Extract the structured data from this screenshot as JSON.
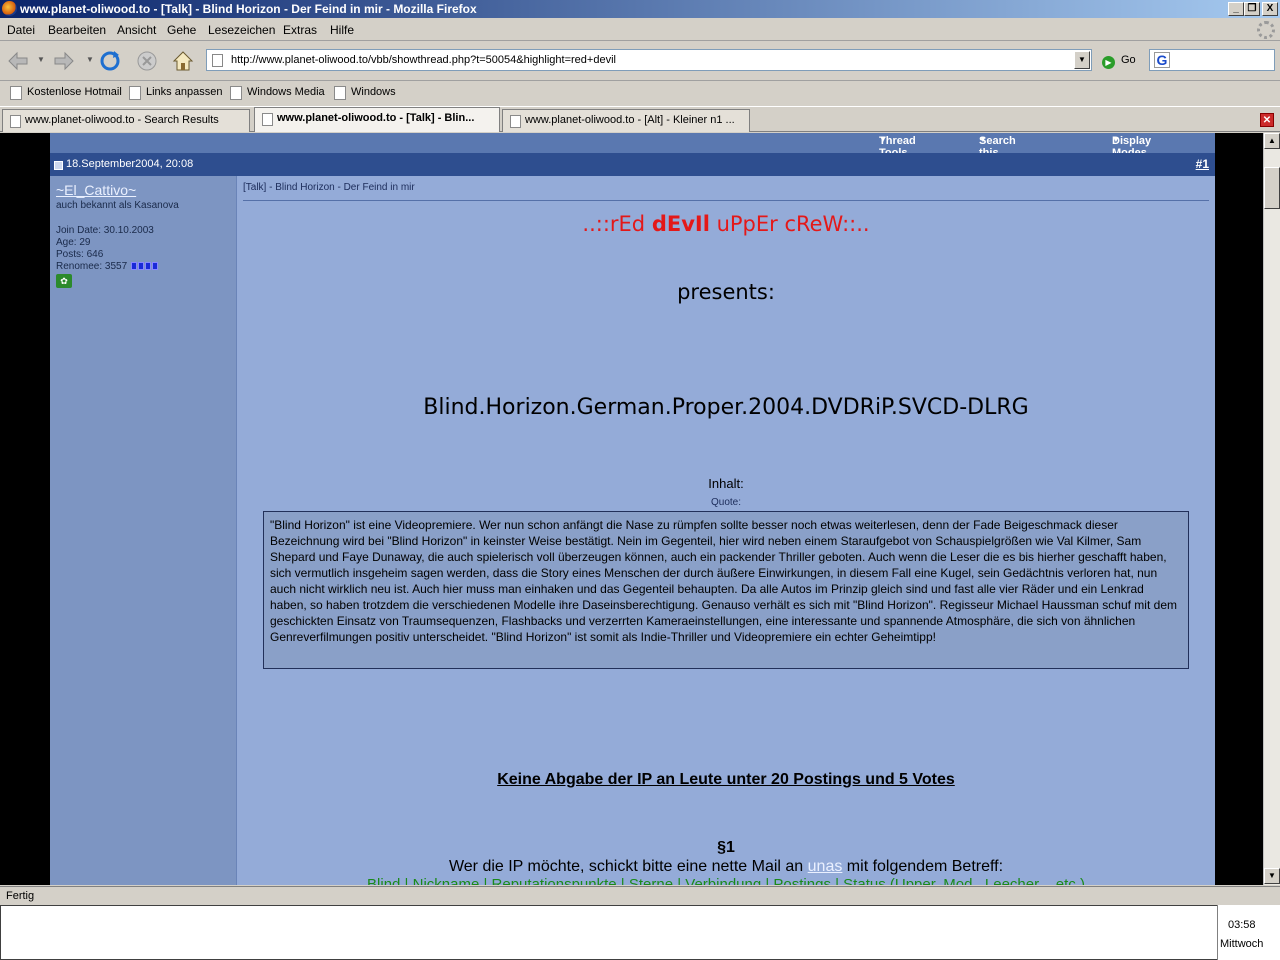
{
  "window": {
    "title": "www.planet-oliwood.to - [Talk] - Blind Horizon - Der Feind in mir - Mozilla Firefox",
    "controls": [
      "_",
      "❐",
      "X"
    ]
  },
  "menu": [
    "Datei",
    "Bearbeiten",
    "Ansicht",
    "Gehe",
    "Lesezeichen",
    "Extras",
    "Hilfe"
  ],
  "nav": {
    "url": "http://www.planet-oliwood.to/vbb/showthread.php?t=50054&highlight=red+devil",
    "go_label": "Go"
  },
  "bookmarks": [
    "Kostenlose Hotmail",
    "Links anpassen",
    "Windows Media",
    "Windows"
  ],
  "tabs": [
    {
      "label": "www.planet-oliwood.to - Search Results",
      "active": false
    },
    {
      "label": "www.planet-oliwood.to - [Talk] - Blin...",
      "active": true
    },
    {
      "label": "www.planet-oliwood.to - [Alt] - Kleiner n1 ...",
      "active": false
    }
  ],
  "thread_tools": [
    "Thread Tools",
    "Search this Thread",
    "Display Modes"
  ],
  "post": {
    "date": "18.September2004, 20:08",
    "number": "#1",
    "user": {
      "name": "~El_Cattivo~",
      "title": "auch bekannt als Kasanova",
      "join_date": "Join Date: 30.10.2003",
      "age": "Age: 29",
      "posts": "Posts: 646",
      "renomee": "Renomee: 3557"
    },
    "title": "[Talk] - Blind Horizon - Der Feind in mir",
    "crew_pre": "..::rEd ",
    "crew_bold": "dEvIl",
    "crew_post": " uPpEr cReW::..",
    "presents": "presents:",
    "release": "Blind.Horizon.German.Proper.2004.DVDRiP.SVCD-DLRG",
    "inhalt": "Inhalt:",
    "quote_label": "Quote:",
    "quote": "\"Blind Horizon\" ist eine Videopremiere. Wer nun schon anfängt die Nase zu rümpfen sollte besser noch etwas weiterlesen, denn der Fade Beigeschmack dieser Bezeichnung wird bei \"Blind Horizon\" in keinster Weise bestätigt. Nein im Gegenteil, hier wird neben einem Staraufgebot von Schauspielgrößen wie Val Kilmer, Sam Shepard und Faye Dunaway, die auch spielerisch voll überzeugen können, auch ein packender Thriller geboten. Auch wenn die Leser die es bis hierher geschafft haben, sich vermutlich insgeheim sagen werden, dass die Story eines Menschen der durch äußere Einwirkungen, in diesem Fall eine Kugel, sein Gedächtnis verloren hat, nun auch nicht wirklich neu ist. Auch hier muss man einhaken und das Gegenteil behaupten. Da alle Autos im Prinzip gleich sind und fast alle vier Räder und ein Lenkrad haben, so haben trotzdem die verschiedenen Modelle ihre Daseinsberechtigung. Genauso verhält es sich mit \"Blind Horizon\". Regisseur Michael Haussman schuf mit dem geschickten Einsatz von Traumsequenzen, Flashbacks und verzerrten Kameraeinstellungen, eine interessante und spannende Atmosphäre, die sich von ähnlichen Genreverfilmungen positiv unterscheidet. \"Blind Horizon\" ist somit als Indie-Thriller und Videopremiere ein echter Geheimtipp!",
    "rules": "Keine Abgabe der IP an Leute unter 20 Postings und 5 Votes",
    "paragraph": "§1",
    "wer_pre": "Wer die IP möchte, schickt bitte eine nette Mail an ",
    "wer_link": "unas",
    "wer_post": " mit folgendem Betreff:",
    "green_line": "Blind | Nickname | Reputationspunkte | Sterne | Verbindung | Postings | Status (Upper, Mod., Leecher ...etc.)"
  },
  "status": "Fertig",
  "clock": {
    "time": "03:58",
    "day": "Mittwoch"
  }
}
